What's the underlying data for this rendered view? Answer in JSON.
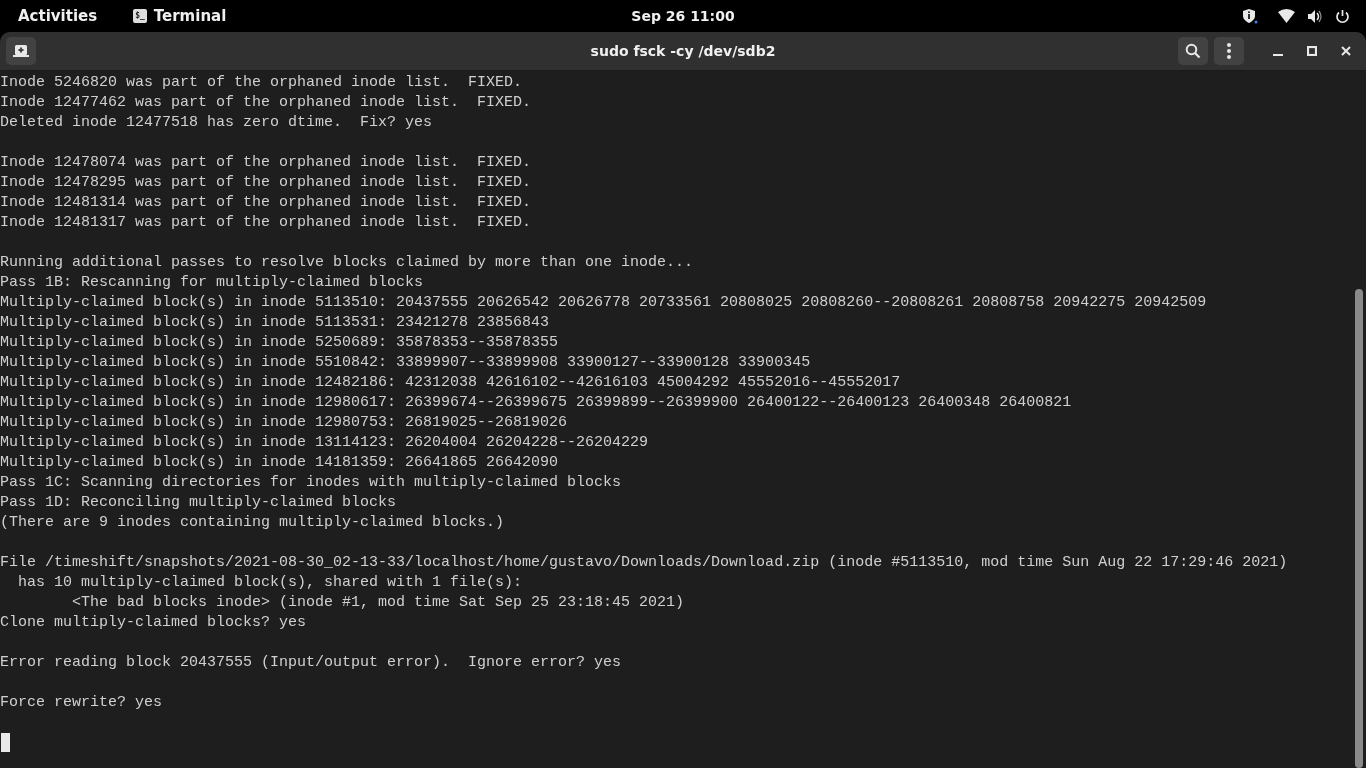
{
  "top_bar": {
    "activities": "Activities",
    "app_icon_text": "$_",
    "app_name": "Terminal",
    "clock": "Sep 26  11:00"
  },
  "window": {
    "title": "sudo fsck -cy /dev/sdb2"
  },
  "terminal": {
    "blocks": [
      [
        "Inode 5246820 was part of the orphaned inode list.  FIXED.",
        "Inode 12477462 was part of the orphaned inode list.  FIXED.",
        "Deleted inode 12477518 has zero dtime.  Fix? yes"
      ],
      [
        "Inode 12478074 was part of the orphaned inode list.  FIXED.",
        "Inode 12478295 was part of the orphaned inode list.  FIXED.",
        "Inode 12481314 was part of the orphaned inode list.  FIXED.",
        "Inode 12481317 was part of the orphaned inode list.  FIXED."
      ],
      [
        "Running additional passes to resolve blocks claimed by more than one inode...",
        "Pass 1B: Rescanning for multiply-claimed blocks",
        "Multiply-claimed block(s) in inode 5113510: 20437555 20626542 20626778 20733561 20808025 20808260--20808261 20808758 20942275 20942509",
        "Multiply-claimed block(s) in inode 5113531: 23421278 23856843",
        "Multiply-claimed block(s) in inode 5250689: 35878353--35878355",
        "Multiply-claimed block(s) in inode 5510842: 33899907--33899908 33900127--33900128 33900345",
        "Multiply-claimed block(s) in inode 12482186: 42312038 42616102--42616103 45004292 45552016--45552017",
        "Multiply-claimed block(s) in inode 12980617: 26399674--26399675 26399899--26399900 26400122--26400123 26400348 26400821",
        "Multiply-claimed block(s) in inode 12980753: 26819025--26819026",
        "Multiply-claimed block(s) in inode 13114123: 26204004 26204228--26204229",
        "Multiply-claimed block(s) in inode 14181359: 26641865 26642090",
        "Pass 1C: Scanning directories for inodes with multiply-claimed blocks",
        "Pass 1D: Reconciling multiply-claimed blocks",
        "(There are 9 inodes containing multiply-claimed blocks.)"
      ],
      [
        "File /timeshift/snapshots/2021-08-30_02-13-33/localhost/home/gustavo/Downloads/Download.zip (inode #5113510, mod time Sun Aug 22 17:29:46 2021)",
        "  has 10 multiply-claimed block(s), shared with 1 file(s):",
        "        <The bad blocks inode> (inode #1, mod time Sat Sep 25 23:18:45 2021)",
        "Clone multiply-claimed blocks? yes"
      ],
      [
        "Error reading block 20437555 (Input/output error).  Ignore error? yes"
      ],
      [
        "Force rewrite? yes"
      ]
    ]
  }
}
